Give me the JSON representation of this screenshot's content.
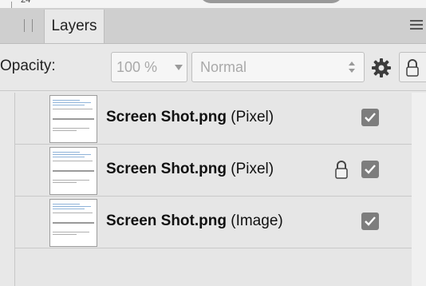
{
  "top_fragment": {
    "text": "24"
  },
  "panel": {
    "tab_label": "Layers"
  },
  "options": {
    "opacity_label": "Opacity:",
    "opacity_value": "100 %",
    "blend_mode": "Normal"
  },
  "layers": [
    {
      "name": "Screen Shot.png",
      "type": "(Pixel)",
      "visible": true,
      "locked": false
    },
    {
      "name": "Screen Shot.png",
      "type": "(Pixel)",
      "visible": true,
      "locked": true
    },
    {
      "name": "Screen Shot.png",
      "type": "(Image)",
      "visible": true,
      "locked": false
    }
  ],
  "icons": {
    "panel_menu": "hamburger-menu-icon",
    "settings": "gear-icon",
    "lock": "padlock-icon",
    "visibility": "checkbox-check-icon"
  },
  "colors": {
    "panel_bg": "#e8e8e8",
    "tab_bar_bg": "#cfcfcf",
    "checkbox": "#7d7d7d"
  }
}
